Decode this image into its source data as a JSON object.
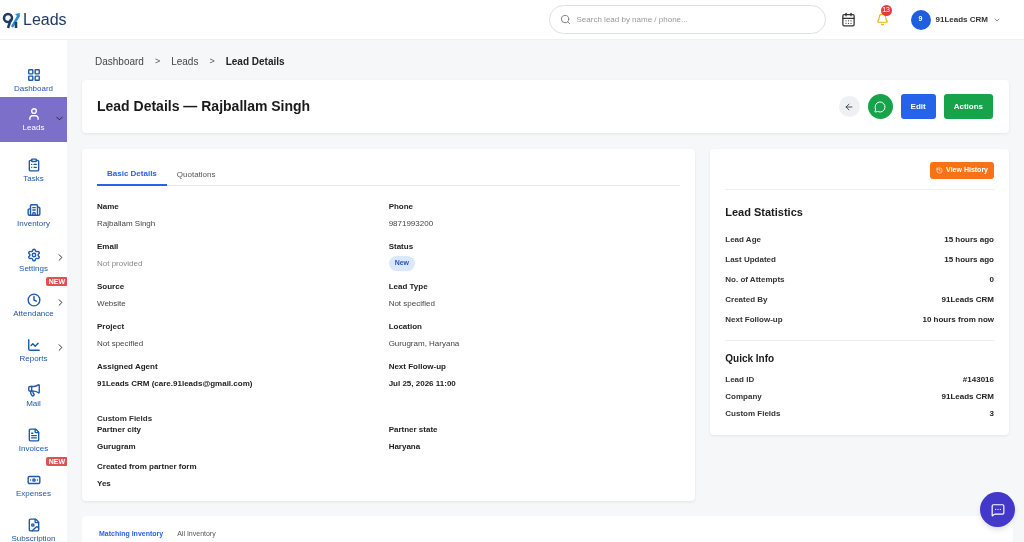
{
  "brand": {
    "logo_text": "Leads"
  },
  "search": {
    "placeholder": "Search lead by name / phone..."
  },
  "notifications": {
    "count": "13"
  },
  "user": {
    "avatar": "9",
    "name": "91Leads CRM"
  },
  "sidebar": {
    "items": [
      {
        "label": "Dashboard",
        "selected": false
      },
      {
        "label": "Leads",
        "selected": true,
        "expanded": true
      },
      {
        "label": "Tasks",
        "selected": false
      },
      {
        "label": "Inventory",
        "selected": false
      },
      {
        "label": "Settings",
        "selected": false,
        "expanded": false
      },
      {
        "label": "Attendance",
        "selected": false,
        "expanded": false,
        "badge": "NEW"
      },
      {
        "label": "Reports",
        "selected": false,
        "expanded": false
      },
      {
        "label": "Mail",
        "selected": false
      },
      {
        "label": "Invoices",
        "selected": false
      },
      {
        "label": "Expenses",
        "selected": false,
        "badge": "NEW"
      },
      {
        "label": "Subscription",
        "selected": false
      }
    ]
  },
  "breadcrumb": [
    {
      "label": "Dashboard",
      "current": false
    },
    {
      "label": "Leads",
      "current": false
    },
    {
      "label": "Lead Details",
      "current": true
    }
  ],
  "breadcrumb_separator": ">",
  "page_title": "Lead Details — Rajballam Singh",
  "header_buttons": [
    {
      "kind": "back"
    },
    {
      "kind": "whatsapp"
    },
    {
      "kind": "edit",
      "label": "Edit"
    },
    {
      "kind": "actions",
      "label": "Actions"
    }
  ],
  "detail_tabs": [
    {
      "label": "Basic Details",
      "selected": true
    },
    {
      "label": "Quotations",
      "selected": false
    }
  ],
  "fields": [
    {
      "label": "Name",
      "value": "Rajballam Singh",
      "kind": "text"
    },
    {
      "label": "Phone",
      "value": "9871993200",
      "kind": "text"
    },
    {
      "label": "Email",
      "value": "Not provided",
      "kind": "muted"
    },
    {
      "label": "Status",
      "value": "New",
      "kind": "badge"
    },
    {
      "label": "Source",
      "value": "Website",
      "kind": "text"
    },
    {
      "label": "Lead Type",
      "value": "Not specified",
      "kind": "text"
    },
    {
      "label": "Project",
      "value": "Not specified",
      "kind": "text"
    },
    {
      "label": "Location",
      "value": "Gurugram, Haryana",
      "kind": "text"
    },
    {
      "label": "Assigned Agent",
      "value": "91Leads CRM (care.91leads@gmail.com)",
      "kind": "strong"
    },
    {
      "label": "Next Follow-up",
      "value": "Jul 25, 2026 11:00",
      "kind": "strong"
    }
  ],
  "custom_fields": {
    "title": "Custom Fields",
    "items": [
      {
        "label": "Partner city",
        "value": "Gurugram"
      },
      {
        "label": "Partner state",
        "value": "Haryana"
      },
      {
        "label": "Created from partner form",
        "value": "Yes"
      }
    ]
  },
  "view_history": "View History",
  "lead_statistics": {
    "title": "Lead Statistics",
    "rows": [
      {
        "label": "Lead Age",
        "value": "15 hours ago"
      },
      {
        "label": "Last Updated",
        "value": "15 hours ago"
      },
      {
        "label": "No. of Attempts",
        "value": "0"
      },
      {
        "label": "Created By",
        "value": "91Leads CRM"
      },
      {
        "label": "Next Follow-up",
        "value": "10 hours from now"
      }
    ]
  },
  "quick_info": {
    "title": "Quick Info",
    "rows": [
      {
        "label": "Lead ID",
        "value": "#143016"
      },
      {
        "label": "Company",
        "value": "91Leads CRM"
      },
      {
        "label": "Custom Fields",
        "value": "3"
      }
    ]
  },
  "inventory_tabs": [
    {
      "label": "Matching Inventory",
      "selected": true
    },
    {
      "label": "All Inventory",
      "selected": false
    }
  ]
}
